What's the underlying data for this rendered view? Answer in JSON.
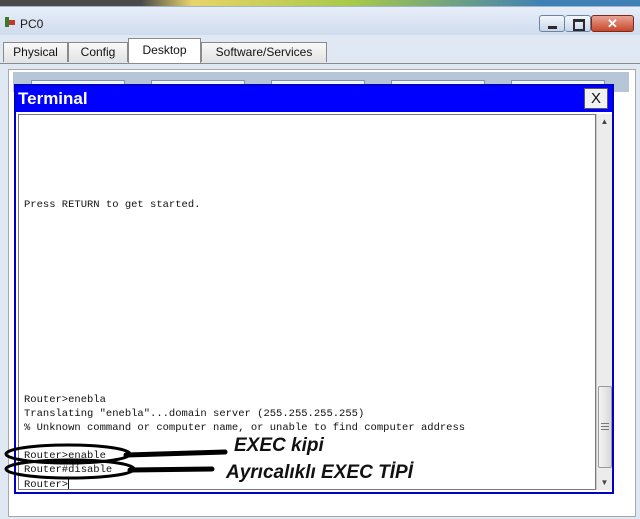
{
  "window": {
    "title": "PC0"
  },
  "tabs": [
    {
      "label": "Physical"
    },
    {
      "label": "Config"
    },
    {
      "label": "Desktop",
      "active": true
    },
    {
      "label": "Software/Services"
    }
  ],
  "terminal": {
    "title": "Terminal",
    "close_label": "X",
    "lines": [
      "Press RETURN to get started.",
      "Router>enebla",
      "Translating \"enebla\"...domain server (255.255.255.255)",
      "% Unknown command or computer name, or unable to find computer address",
      "Router>enable",
      "Router#disable",
      "Router>"
    ]
  },
  "annotations": {
    "exec_mode": "EXEC kipi",
    "privileged_exec_mode": "Ayrıcalıklı EXEC TİPİ"
  },
  "colors": {
    "terminal_titlebar": "#0000ff",
    "terminal_border": "#0000c8"
  }
}
